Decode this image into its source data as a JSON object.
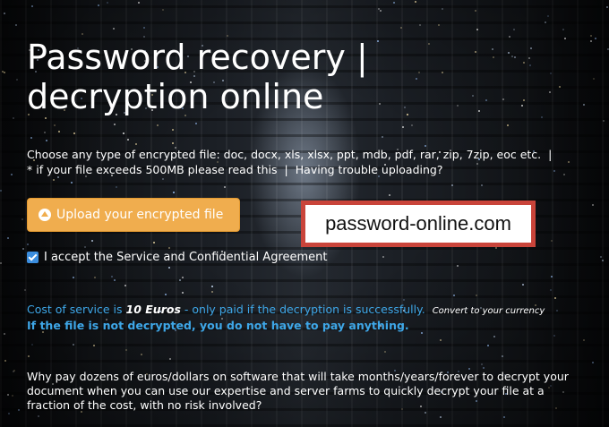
{
  "page": {
    "headline_line1": "Password recovery |",
    "headline_line2": "decryption online",
    "file_types_text": "Choose any type of encrypted file: doc, docx, xls, xlsx, ppt, mdb, pdf, rar, zip, 7zip, eoc etc.",
    "separator": "|",
    "exceeds_text": "* if your file exceeds 500MB please read this",
    "trouble_link": "Having trouble uploading?",
    "upload_button": "Upload your encrypted file",
    "watermark": "password-online.com",
    "accept_label": "I accept the Service and Confidential Agreement",
    "cost_prefix": "Cost of service is",
    "cost_amount": "10 Euros",
    "cost_suffix": "- only paid if the decryption is successfully.",
    "convert_link": "Convert to your currency",
    "no_pay_text": "If the file is not decrypted, you do not have to pay anything.",
    "why_text": "Why pay dozens of euros/dollars on software that will take months/years/forever to decrypt your document when you can use our expertise and server farms to quickly decrypt your file at a fraction of the cost, with no risk involved?"
  },
  "colors": {
    "accent_orange": "#f0ad4e",
    "link_blue": "#3ea7e8",
    "watermark_border": "#c9443a"
  }
}
